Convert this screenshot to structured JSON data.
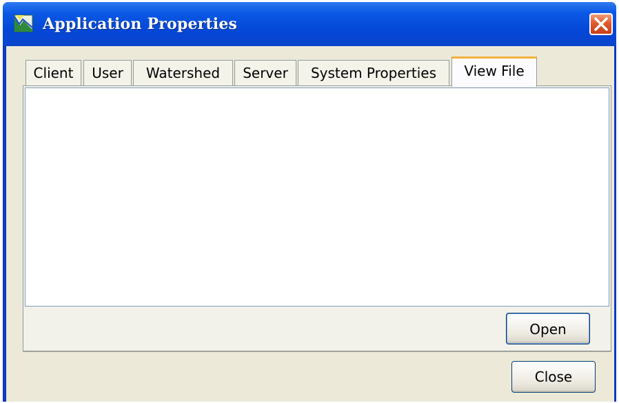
{
  "window": {
    "title": "Application Properties",
    "icon": "app-map-icon",
    "close_icon": "close-x-icon"
  },
  "tabs": [
    {
      "label": "Client",
      "active": false
    },
    {
      "label": "User",
      "active": false
    },
    {
      "label": "Watershed",
      "active": false
    },
    {
      "label": "Server",
      "active": false
    },
    {
      "label": "System Properties",
      "active": false
    },
    {
      "label": "View File",
      "active": true
    }
  ],
  "panel": {
    "viewer_content": "",
    "open_label": "Open"
  },
  "footer": {
    "close_label": "Close"
  },
  "colors": {
    "titlebar": "#0a58e4",
    "client_bg": "#ece9d8",
    "active_tab_accent": "#f2b13c",
    "close_button": "#e05a2c"
  }
}
